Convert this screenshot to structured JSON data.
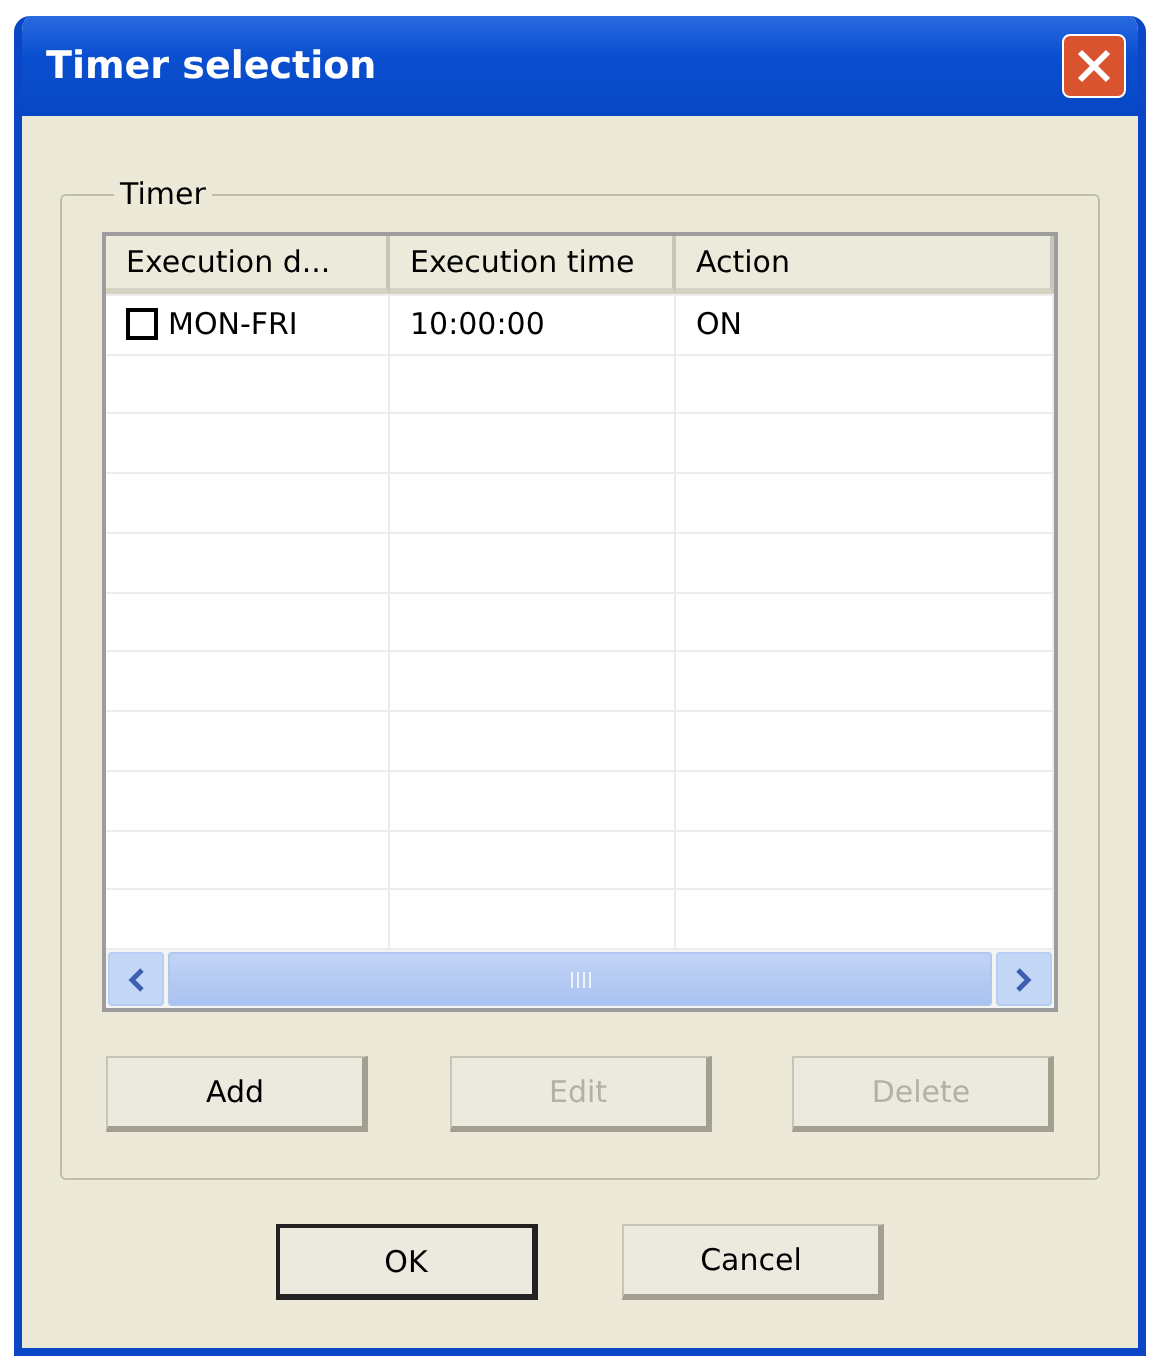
{
  "window": {
    "title": "Timer selection"
  },
  "group": {
    "label": "Timer"
  },
  "table": {
    "columns": [
      "Execution d...",
      "Execution time",
      "Action"
    ],
    "rows": [
      {
        "checked": false,
        "cells": [
          "MON-FRI",
          "10:00:00",
          "ON"
        ]
      }
    ]
  },
  "buttons": [
    {
      "label": "Add",
      "disabled": false
    },
    {
      "label": "Edit",
      "disabled": true
    },
    {
      "label": "Delete",
      "disabled": true
    }
  ],
  "dialog_buttons": [
    {
      "label": "OK",
      "default": true
    },
    {
      "label": "Cancel",
      "default": false
    }
  ]
}
